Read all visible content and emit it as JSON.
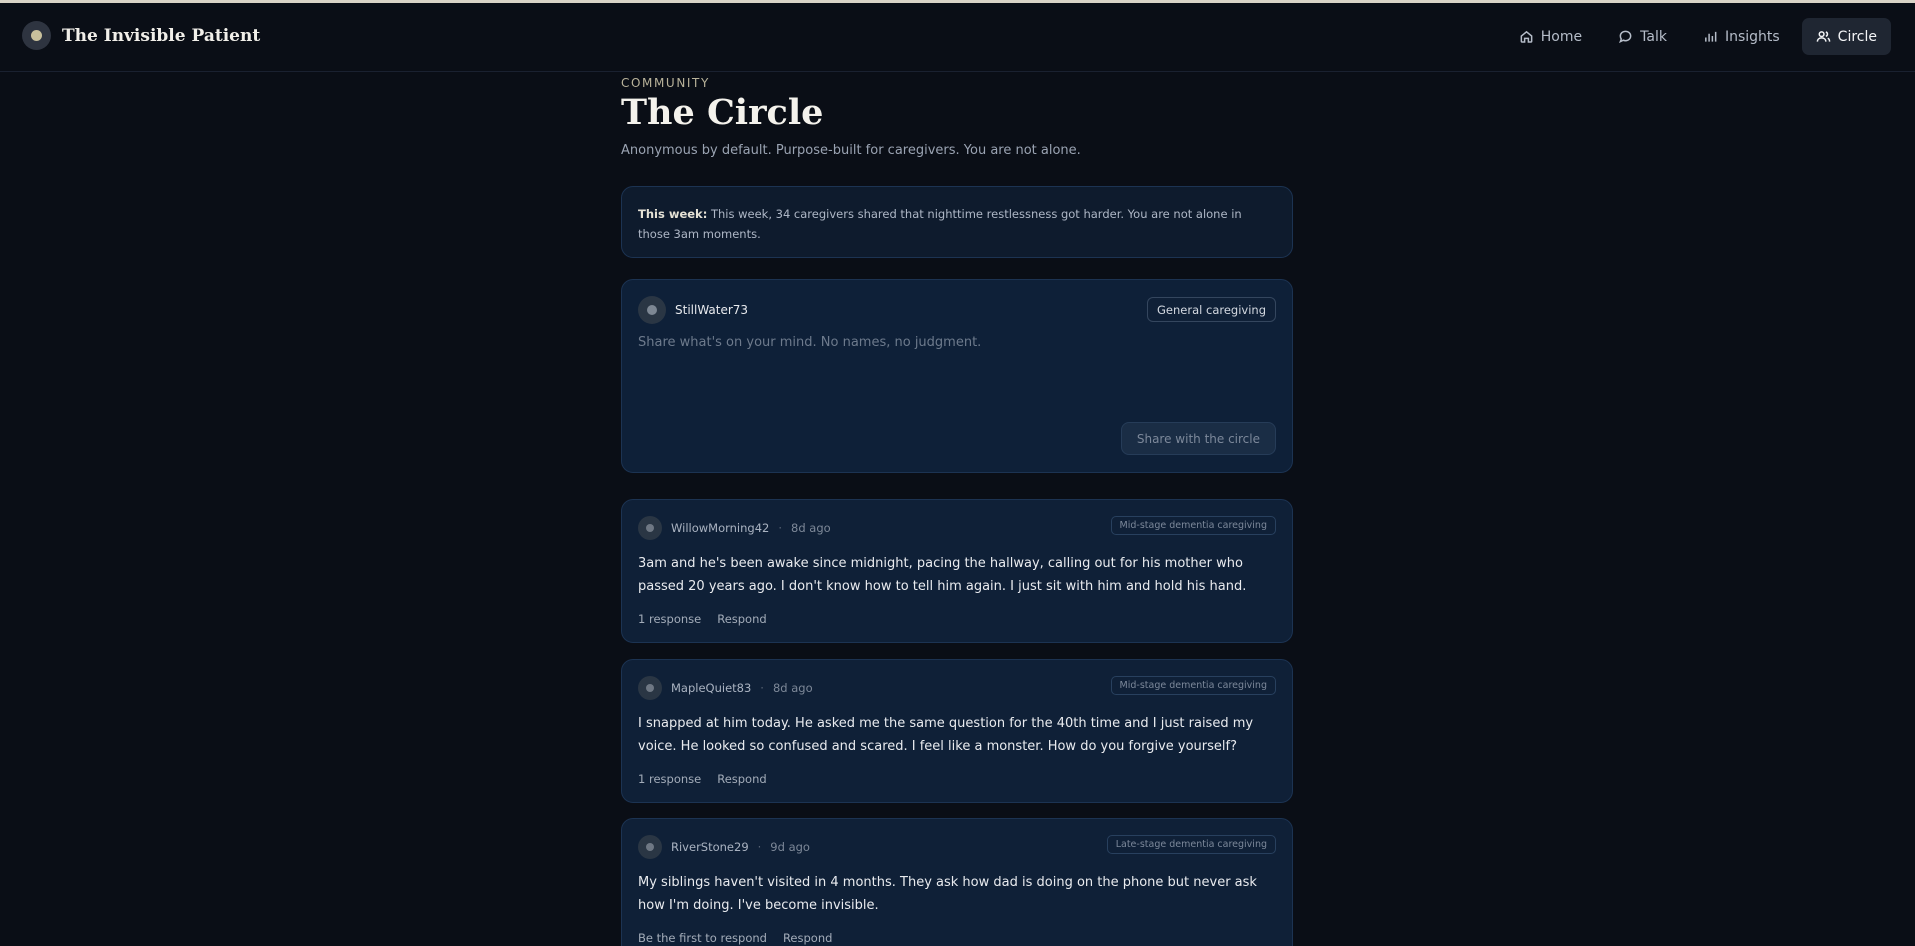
{
  "app": {
    "title": "The Invisible Patient"
  },
  "nav": [
    {
      "label": "Home",
      "icon": "home-icon"
    },
    {
      "label": "Talk",
      "icon": "chat-bubble-icon"
    },
    {
      "label": "Insights",
      "icon": "bar-chart-icon"
    },
    {
      "label": "Circle",
      "icon": "people-icon",
      "active": true
    }
  ],
  "page": {
    "eyebrow": "COMMUNITY",
    "title": "The Circle",
    "subtitle": "Anonymous by default. Purpose-built for caregivers. You are not alone."
  },
  "notice": {
    "label": "This week:",
    "text": " This week, 34 caregivers shared that nighttime restlessness got harder. You are not alone in those 3am moments."
  },
  "composer": {
    "username": "StillWater73",
    "topic": "General caregiving",
    "placeholder": "Share what's on your mind. No names, no judgment.",
    "submit_label": "Share with the circle"
  },
  "posts": [
    {
      "username": "WillowMorning42",
      "sep": "·",
      "time": "8d ago",
      "tag": "Mid-stage dementia caregiving",
      "body": "3am and he's been awake since midnight, pacing the hallway, calling out for his mother who passed 20 years ago. I don't know how to tell him again. I just sit with him and hold his hand.",
      "responses": "1 response",
      "respond": "Respond"
    },
    {
      "username": "MapleQuiet83",
      "sep": "·",
      "time": "8d ago",
      "tag": "Mid-stage dementia caregiving",
      "body": "I snapped at him today. He asked me the same question for the 40th time and I just raised my voice. He looked so confused and scared. I feel like a monster. How do you forgive yourself?",
      "responses": "1 response",
      "respond": "Respond"
    },
    {
      "username": "RiverStone29",
      "sep": "·",
      "time": "9d ago",
      "tag": "Late-stage dementia caregiving",
      "body": "My siblings haven't visited in 4 months. They ask how dad is doing on the phone but never ask how I'm doing. I've become invisible.",
      "responses": "Be the first to respond",
      "respond": "Respond"
    }
  ]
}
